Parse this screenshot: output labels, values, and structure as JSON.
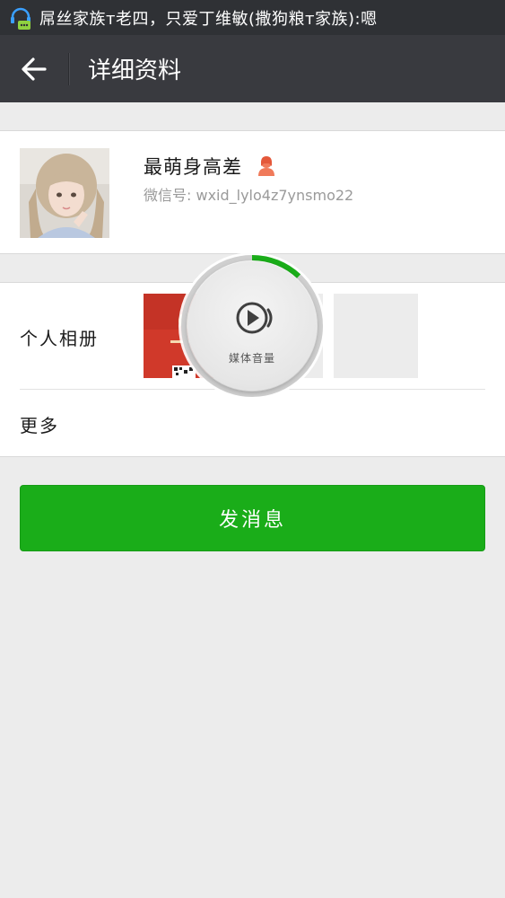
{
  "status_bar": {
    "notification_text": "屌丝家族ᴛ老四，只爱丁维敏(撒狗粮ᴛ家族):嗯"
  },
  "action_bar": {
    "title": "详细资料"
  },
  "profile": {
    "name": "最萌身高差",
    "wxid_label": "微信号: ",
    "wxid_value": "wxid_lylo4z7ynsmo22",
    "gender_icon": "female-user-icon"
  },
  "album": {
    "label": "个人相册",
    "thumbnails": 3
  },
  "more": {
    "label": "更多"
  },
  "send_button": {
    "label": "发消息"
  },
  "volume_overlay": {
    "label": "媒体音量",
    "level": 0.12
  },
  "colors": {
    "status_bar": "#2f3135",
    "action_bar": "#393a3f",
    "accent_green": "#1aad19",
    "background": "#ececec"
  }
}
